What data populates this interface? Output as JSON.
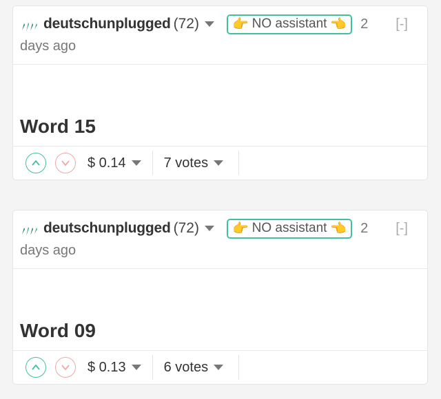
{
  "posts": [
    {
      "author": "deutschunplugged",
      "reputation": "(72)",
      "badge": {
        "left_icon": "👉",
        "text": "NO assistant",
        "right_icon": "👈"
      },
      "time_a": "2",
      "time_b": "days ago",
      "collapse": "[-]",
      "title": "Word 15",
      "payout": "$ 0.14",
      "votes": "7 votes"
    },
    {
      "author": "deutschunplugged",
      "reputation": "(72)",
      "badge": {
        "left_icon": "👉",
        "text": "NO assistant",
        "right_icon": "👈"
      },
      "time_a": "2",
      "time_b": "days ago",
      "collapse": "[-]",
      "title": "Word 09",
      "payout": "$ 0.13",
      "votes": "6 votes"
    }
  ],
  "colors": {
    "accent": "#3fc1a0",
    "downvote": "#f0a8a8",
    "background": "#f4f4f4"
  },
  "icons": [
    "steem-avatar-icon",
    "upvote-icon",
    "downvote-icon",
    "caret-down-icon"
  ]
}
